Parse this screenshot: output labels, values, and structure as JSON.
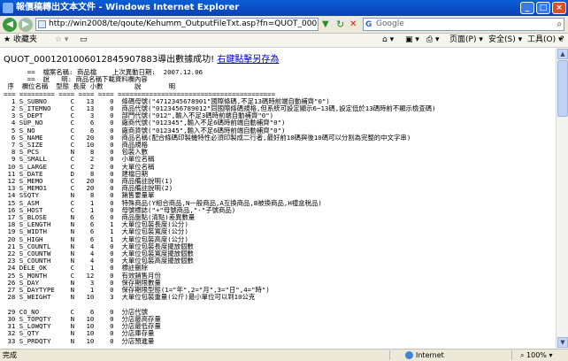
{
  "window": {
    "title": "報價稿轉出文本文件 - Windows Internet Explorer"
  },
  "address_bar": {
    "url": "http://win2008/te/qoute/Kehumm_OutputFileTxt.asp?fn=QUOT_0001201006012845907..."
  },
  "search_bar": {
    "provider": "G",
    "placeholder": "Google"
  },
  "toolbar": {
    "favorites": "收藏夹",
    "page": "页面(P)",
    "safety": "安全(S)",
    "tools": "工具(O)",
    "help": "?"
  },
  "content": {
    "message_prefix": "QUOT_0001201006012845907883導出數據成功!",
    "save_link": "右鍵點擊另存為",
    "report_text": "      ==  檔案名稱: 商品檔    上次異動日期:  2007.12.06\n      ==  說   明: 商品名稱下載資料欄內容\n 序  欄位名稱  型態 長度 小數        說       明\n=== ========= ==== ==== ==== ========================================\n  1 S_SUBNO      C   13    0  條碼母號(\"4712345678901\"國際條碼,不足13碼時前端自動補齊\"0\")\n  2 S_ITEMNO     C   13    0  商品代號(\"0123456789012\"同國際條碼規格,但系統可設定顯示6~13碼,設定低於13碼時前不顯示檢查碼)\n  3 S_DEPT       C    3    0  部門代號(\"012\",輸入不足3碼時前端自動補齊\"0\")\n  4 SUP_NO       C    6    0  廠商代號(\"012345\",輸入不足6碼時前端自動補齊\"0\")\n  5 S_NO         C    6    0  廠商貨號(\"012345\",輸入不足6碼時前端自動補齊\"0\")\n  6 S_NAME       C   20    0  商品名稱(配合條碼印製機特性必須印製成二行者,最好前10碼與後10碼可以分割為完整的中文字串)\n  7 S_SIZE       C   10    0  商品規格\n  8 S_PCS        N    8    0  包裝入數\n  9 S_SMALL      C    2    0  小單位名稱\n 10 S_LARGE      C    2    0  大單位名稱\n 11 S_DATE       D    8    0  建檔日期\n 12 S_MEMO       C   20    0  商品備註說明(1)\n 13 S_MEMO1      C   20    0  商品備註說明(2)\n 14 SSQTY        N    8    0  銷售要量單\n 15 S_ASM        C    1    0  特殊商品(Y組合商品,N一般商品,A互換商品,B被換商品,H禮盒稅品)\n 16 S_HOST       C    1    0  母號標誌(\"+\"母號商品,\"-\"子號商品)\n 17 S_BLOSE      N    6    0  商品盤點(清點)差異數量\n 18 S_LENGTH     N    6    1  大單位包裝長度(公分)\n 19 S_WIDTH      N    6    1  大單位包裝寬度(公分)\n 20 S_HIGH       N    6    1  大單位包裝高度(公分)\n 21 S_COUNTL     N    4    0  大單位包裝長度擺放個數\n 22 S_COUNTW     N    4    0  大單位包裝寬度擺放個數\n 23 S_COUNTH     N    4    0  大單位包裝高度擺放個數\n 24 DELE_OK      C    1    0  標註刪除\n 25 S_MONTH      C   12    0  有效銷售月份\n 26 S_DAY        N    3    0  保存期限數量\n 27 S_DAYTYPE    N    1    0  保存期限型態(1=\"年\",2=\"月\",3=\"日\",4=\"時\")\n 28 S_WEIGHT     N   10    3  大單位包裝重量(公斤)最小單位可以到10公克\n\n 29 CO_NO        C    6    0  分店代號\n 30 S_TOPQTY     N   10    0  分店最高存量\n 31 S_LOWQTY     N   10    0  分店最低存量\n 32 S_QTY        N   10    0  分店庫存量\n 33 S_PRDQTY     N   10    0  分店預進量"
  },
  "status_bar": {
    "left_text": "完成",
    "zone": "Internet",
    "zoom": "100%"
  }
}
